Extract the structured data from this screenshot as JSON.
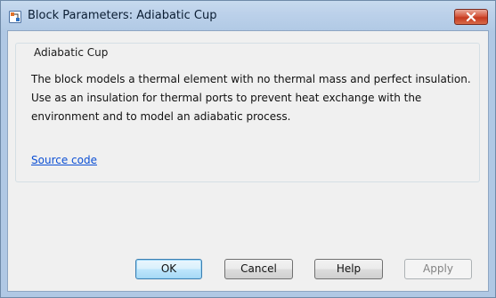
{
  "window": {
    "title": "Block Parameters: Adiabatic Cup"
  },
  "group": {
    "title": "Adiabatic Cup",
    "description": "The block models a thermal element with no thermal mass and perfect insulation. Use as an insulation for thermal ports to prevent heat exchange with the environment and to model an adiabatic process.",
    "link_label": "Source code"
  },
  "buttons": {
    "ok": "OK",
    "cancel": "Cancel",
    "help": "Help",
    "apply": "Apply"
  },
  "icons": {
    "app": "simulink-block-icon",
    "close": "close-icon"
  },
  "colors": {
    "titlebar": "#bcd1ea",
    "close_button": "#c53a20",
    "dialog_background": "#f0f0f0",
    "link": "#0c4fd4",
    "default_button_border": "#3c7fb1",
    "disabled_text": "#838383"
  },
  "state": {
    "apply_enabled": false
  }
}
